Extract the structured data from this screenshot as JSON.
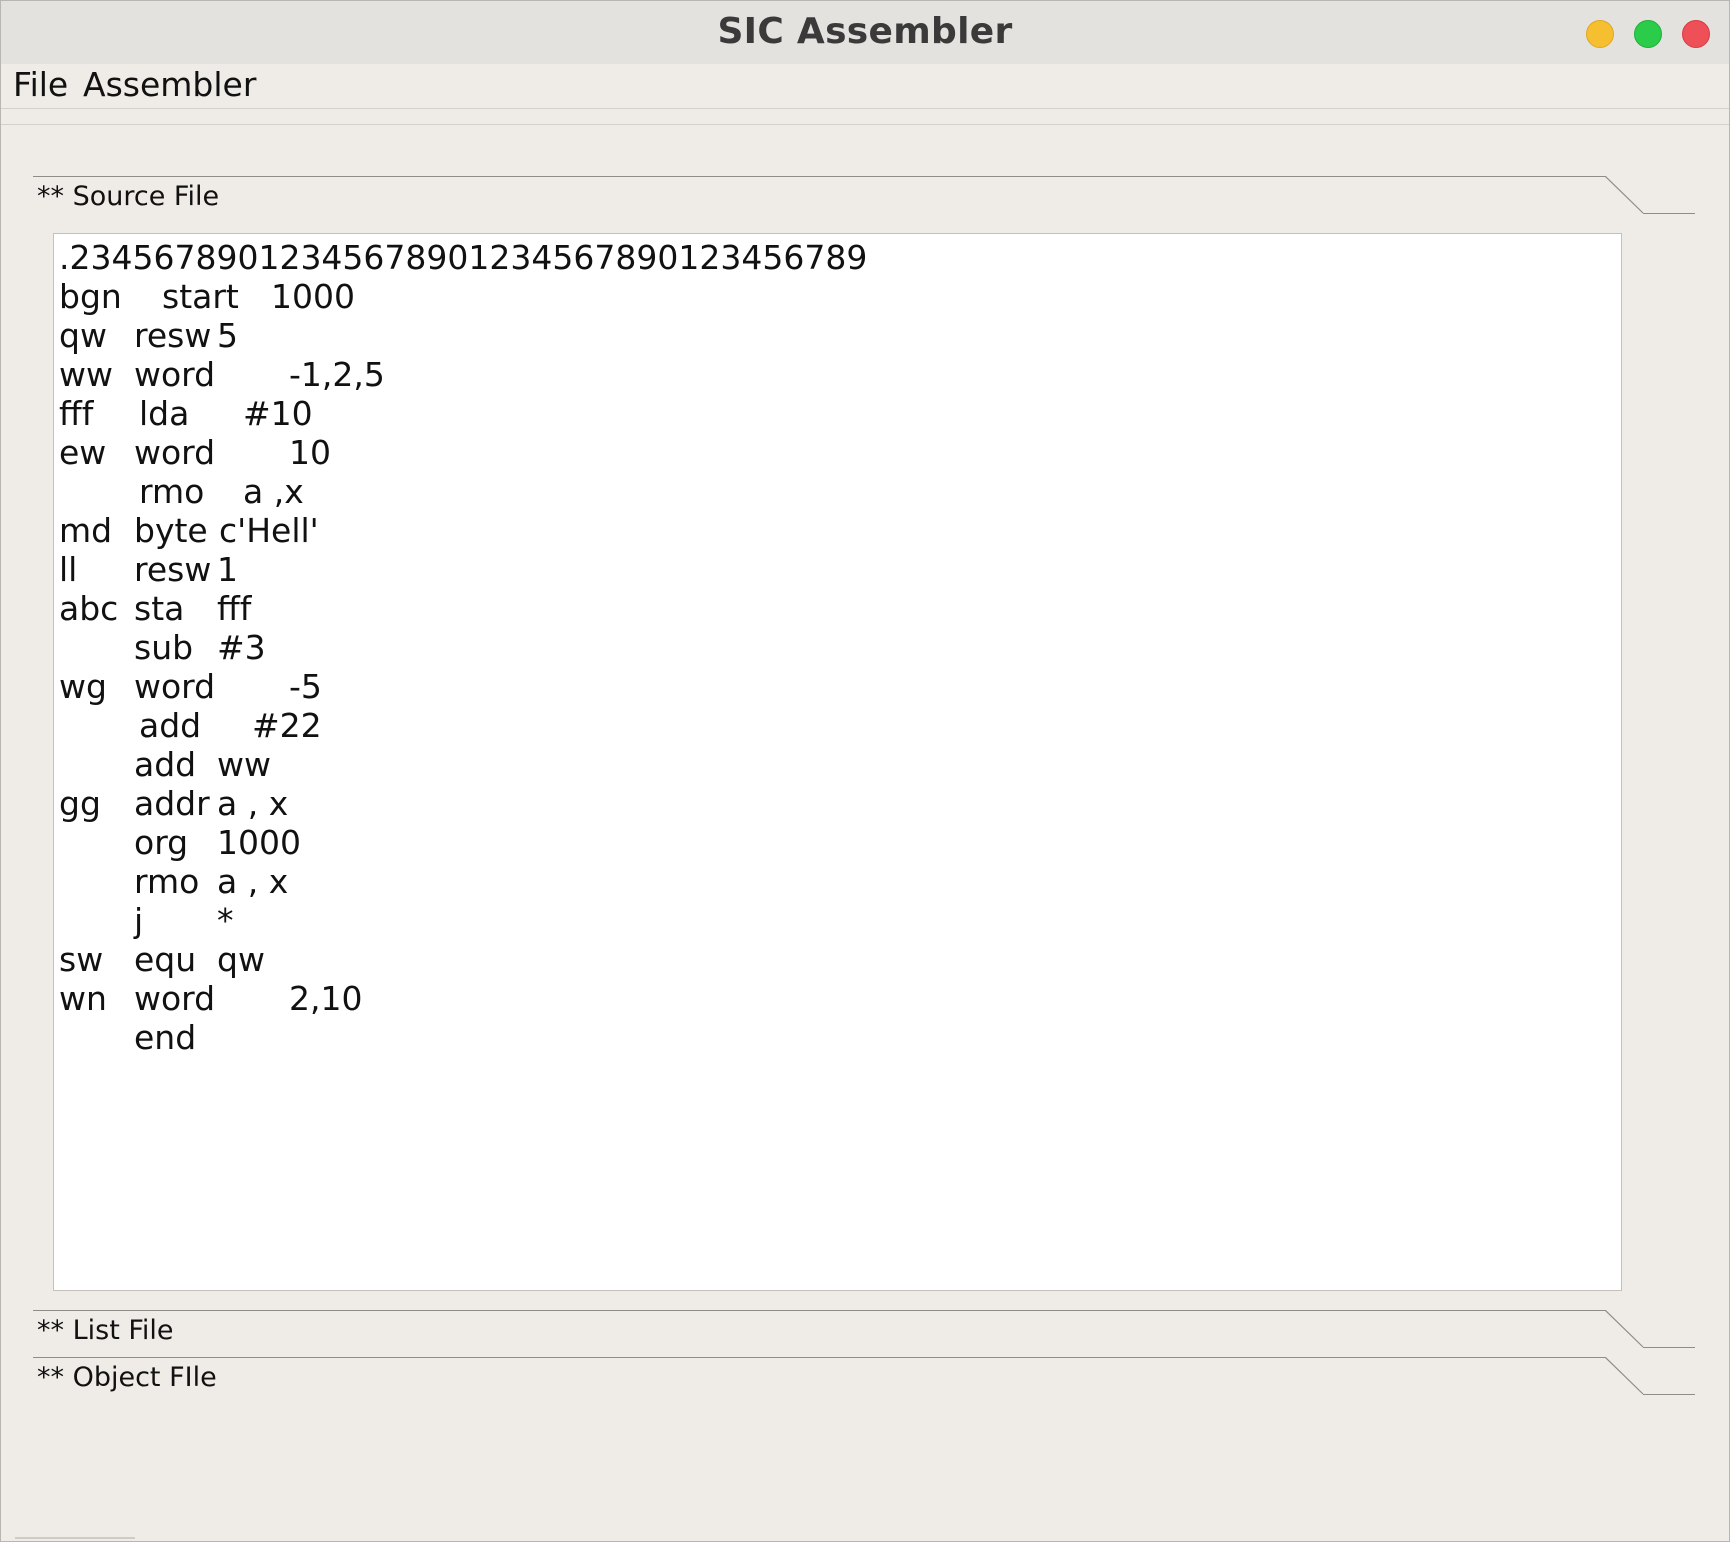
{
  "window": {
    "title": "SIC Assembler",
    "controls": [
      "minimize",
      "maximize",
      "close"
    ]
  },
  "menu": {
    "file": "File",
    "assembler": "Assembler"
  },
  "panes": {
    "source": "** Source File",
    "list": "** List File",
    "object": "** Object FIle"
  },
  "source_lines": [
    [
      ".23456789012345678901234567890123456789",
      "",
      "",
      ""
    ],
    [
      "bgn",
      "",
      "start",
      "1000"
    ],
    [
      "qw",
      "resw",
      "",
      "5"
    ],
    [
      "ww",
      "word",
      "",
      "-1,2,5"
    ],
    [
      "fff",
      "",
      "lda",
      "#10"
    ],
    [
      "ew",
      "word",
      "",
      "10"
    ],
    [
      "",
      "",
      "rmo",
      "a ,x"
    ],
    [
      "md",
      "byte",
      "",
      "c'Hell'"
    ],
    [
      "ll",
      "resw",
      "",
      "1"
    ],
    [
      "abc",
      "sta",
      "",
      "fff"
    ],
    [
      "",
      "sub",
      "",
      "#3"
    ],
    [
      "wg",
      "word",
      "",
      "-5"
    ],
    [
      "",
      "",
      "add",
      "#22"
    ],
    [
      "",
      "add",
      "",
      "ww"
    ],
    [
      "gg",
      "addr",
      "",
      "a , x"
    ],
    [
      "",
      "org",
      "",
      "1000"
    ],
    [
      "",
      "rmo",
      "",
      "a , x"
    ],
    [
      "",
      "j",
      "",
      "*"
    ],
    [
      "sw",
      "equ",
      "",
      "qw"
    ],
    [
      "wn",
      "word",
      "",
      "2,10"
    ],
    [
      "",
      "end",
      "",
      ""
    ]
  ]
}
